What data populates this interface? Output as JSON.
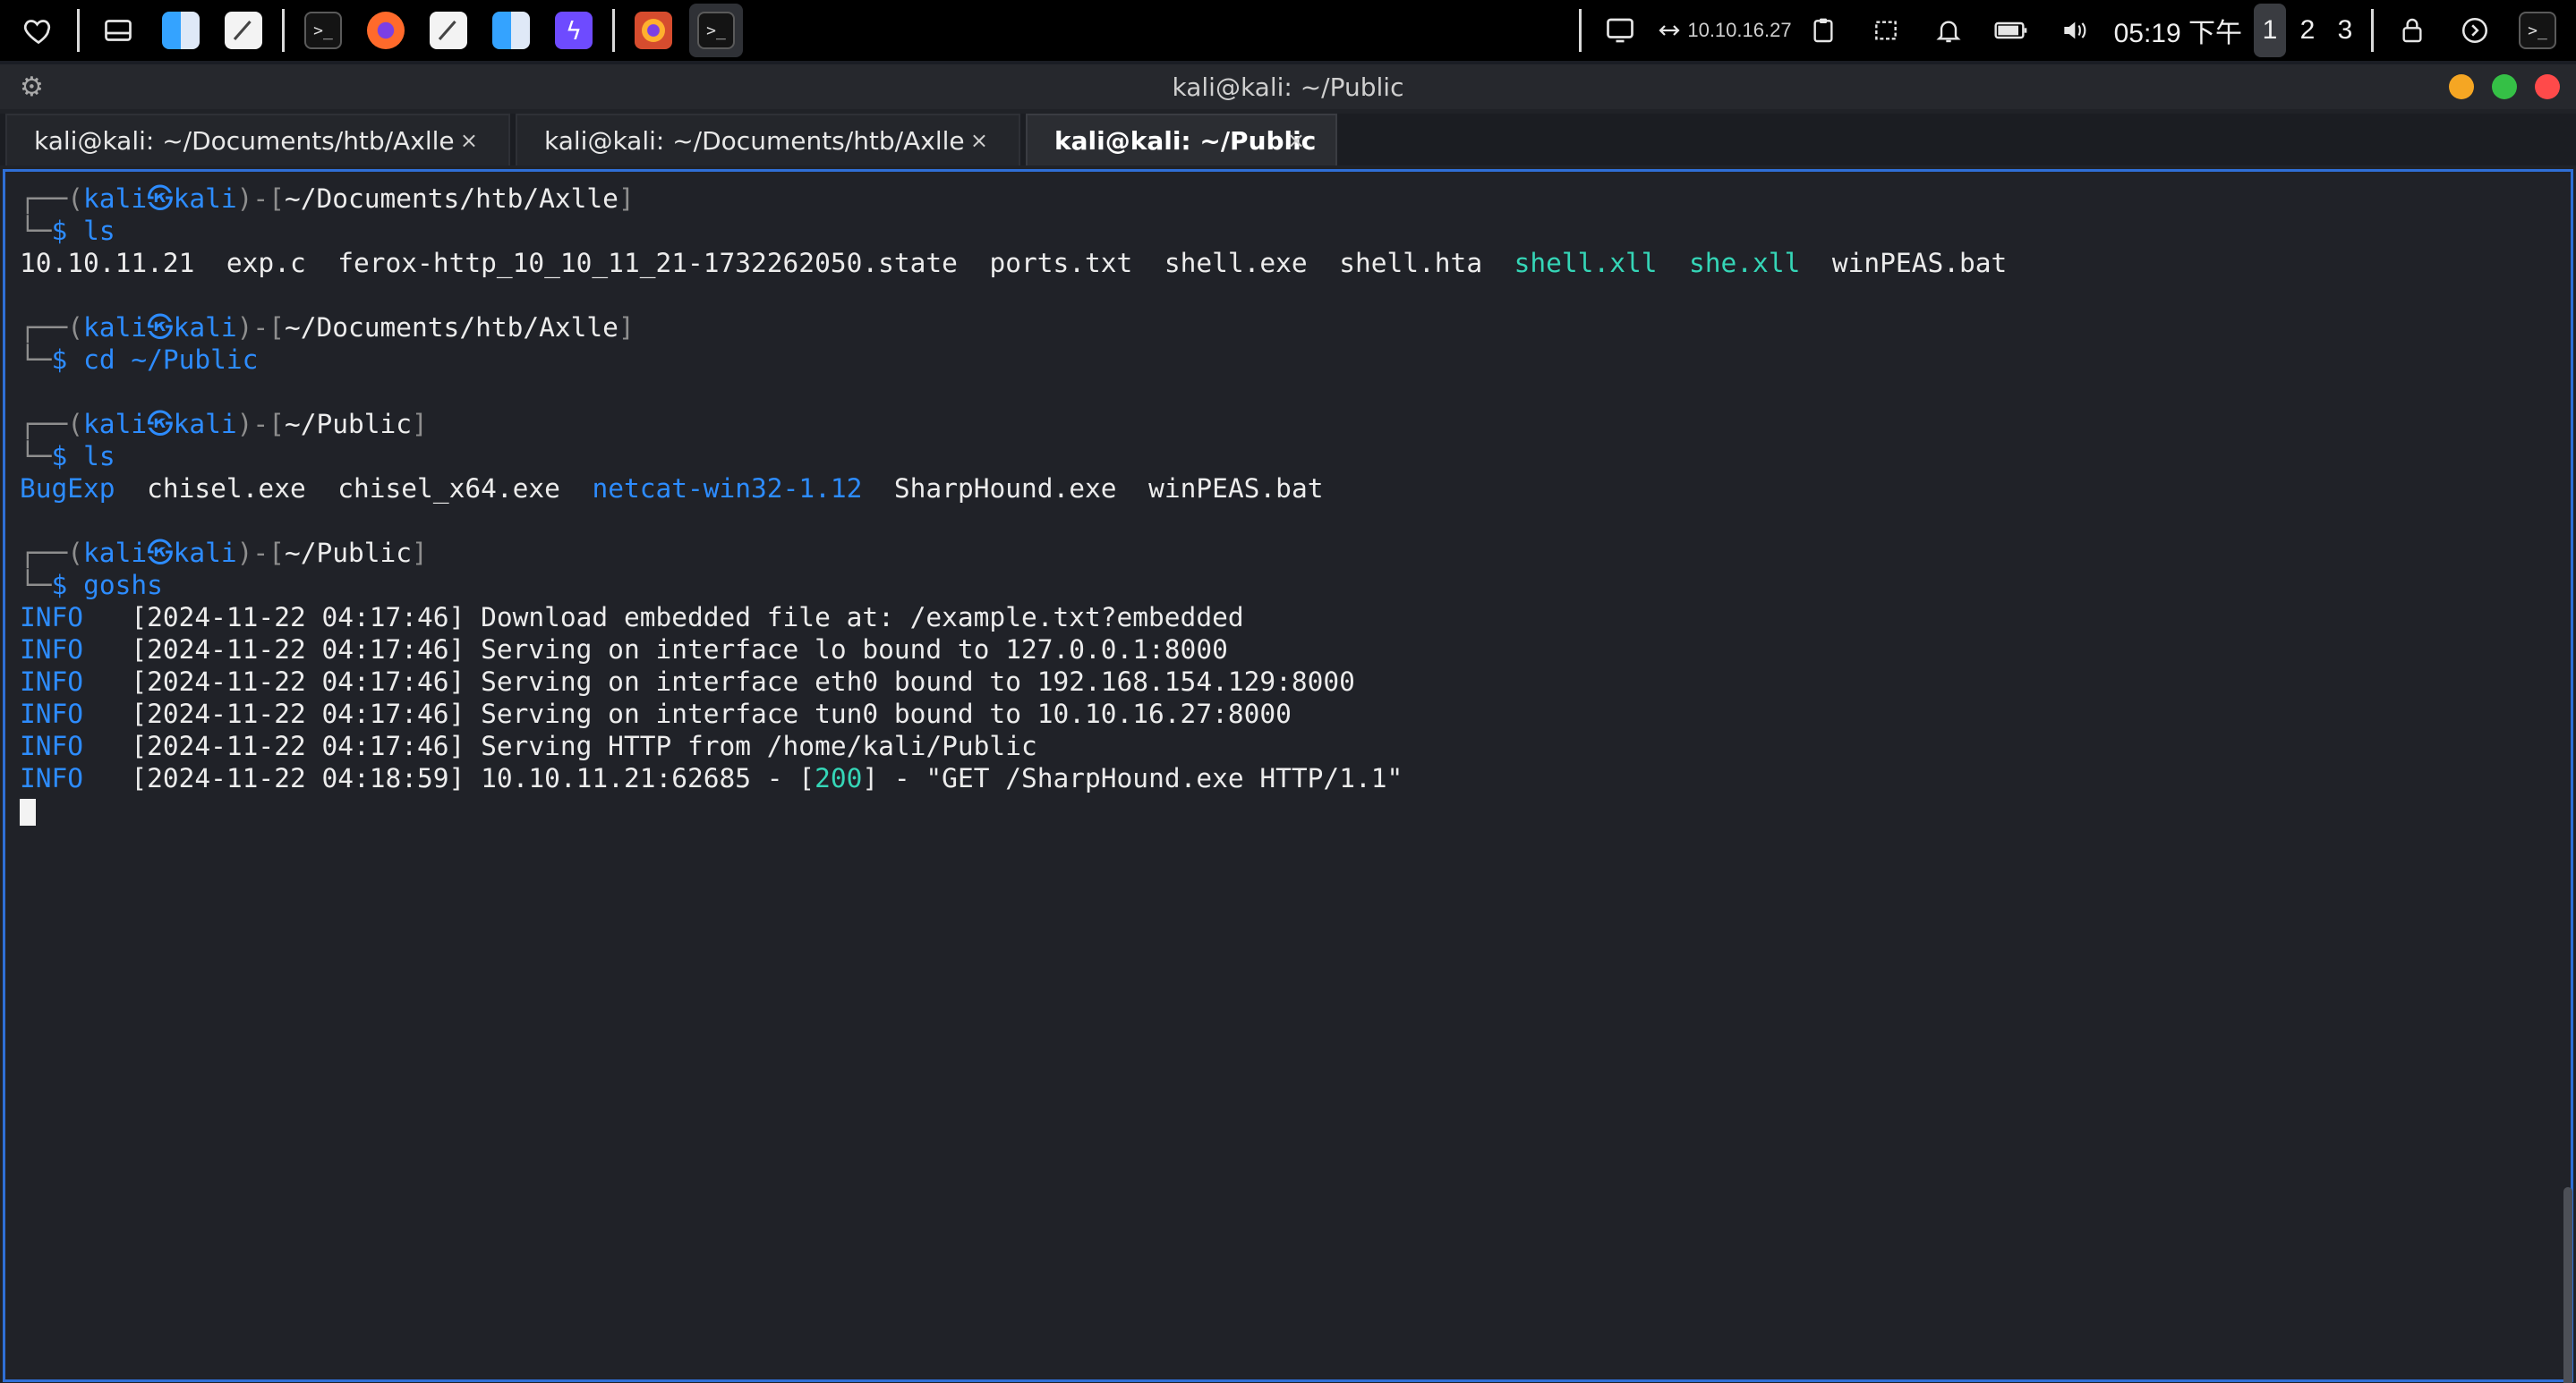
{
  "panel": {
    "left_icons": [
      "heart-icon",
      "files-icon",
      "finder-icon",
      "notes-icon",
      "terminal-icon",
      "firefox-icon",
      "notes-icon",
      "finder-icon",
      "bolt-icon",
      "firefox-icon",
      "terminal-icon"
    ],
    "ip": "10.10.16.27",
    "clock": "05:19 下午",
    "workspaces": [
      "1",
      "2",
      "3"
    ],
    "active_workspace": "1"
  },
  "window": {
    "title": "kali@kali: ~/Public",
    "tabs": [
      {
        "label": "kali@kali: ~/Documents/htb/Axlle",
        "close": "×"
      },
      {
        "label": "kali@kali: ~/Documents/htb/Axlle",
        "close": "×"
      },
      {
        "label": "kali@kali: ~/Public",
        "close": "×"
      }
    ]
  },
  "terminal": {
    "prompt_user": "kali",
    "prompt_at": "㉿",
    "prompt_host": "kali",
    "blocks": [
      {
        "cwd": "~/Documents/htb/Axlle",
        "command": "ls",
        "output_files": [
          {
            "name": "10.10.11.21",
            "kind": "plain"
          },
          {
            "name": "exp.c",
            "kind": "plain"
          },
          {
            "name": "ferox-http_10_10_11_21-1732262050.state",
            "kind": "plain"
          },
          {
            "name": "ports.txt",
            "kind": "plain"
          },
          {
            "name": "shell.exe",
            "kind": "plain"
          },
          {
            "name": "shell.hta",
            "kind": "plain"
          },
          {
            "name": "shell.xll",
            "kind": "teal"
          },
          {
            "name": "she.xll",
            "kind": "teal"
          },
          {
            "name": "winPEAS.bat",
            "kind": "plain"
          }
        ]
      },
      {
        "cwd": "~/Documents/htb/Axlle",
        "command": "cd ~/Public"
      },
      {
        "cwd": "~/Public",
        "command": "ls",
        "output_files": [
          {
            "name": "BugExp",
            "kind": "dir"
          },
          {
            "name": "chisel.exe",
            "kind": "plain"
          },
          {
            "name": "chisel_x64.exe",
            "kind": "plain"
          },
          {
            "name": "netcat-win32-1.12",
            "kind": "dir"
          },
          {
            "name": "SharpHound.exe",
            "kind": "plain"
          },
          {
            "name": "winPEAS.bat",
            "kind": "plain"
          }
        ]
      },
      {
        "cwd": "~/Public",
        "command": "goshs"
      }
    ],
    "log": [
      {
        "level": "INFO",
        "ts": "[2024-11-22 04:17:46]",
        "msg": "Download embedded file at: /example.txt?embedded"
      },
      {
        "level": "INFO",
        "ts": "[2024-11-22 04:17:46]",
        "msg": "Serving on interface lo bound to 127.0.0.1:8000"
      },
      {
        "level": "INFO",
        "ts": "[2024-11-22 04:17:46]",
        "msg": "Serving on interface eth0 bound to 192.168.154.129:8000"
      },
      {
        "level": "INFO",
        "ts": "[2024-11-22 04:17:46]",
        "msg": "Serving on interface tun0 bound to 10.10.16.27:8000"
      },
      {
        "level": "INFO",
        "ts": "[2024-11-22 04:17:46]",
        "msg": "Serving HTTP from /home/kali/Public"
      },
      {
        "level": "INFO",
        "ts": "[2024-11-22 04:18:59]",
        "msg_pre": "10.10.11.21:62685 - [",
        "status": "200",
        "msg_post": "] - \"GET /SharpHound.exe HTTP/1.1\""
      }
    ]
  },
  "colors": {
    "accent_blue": "#2d8cff",
    "teal": "#35d6b7",
    "border_blue": "#2f6fd6"
  }
}
